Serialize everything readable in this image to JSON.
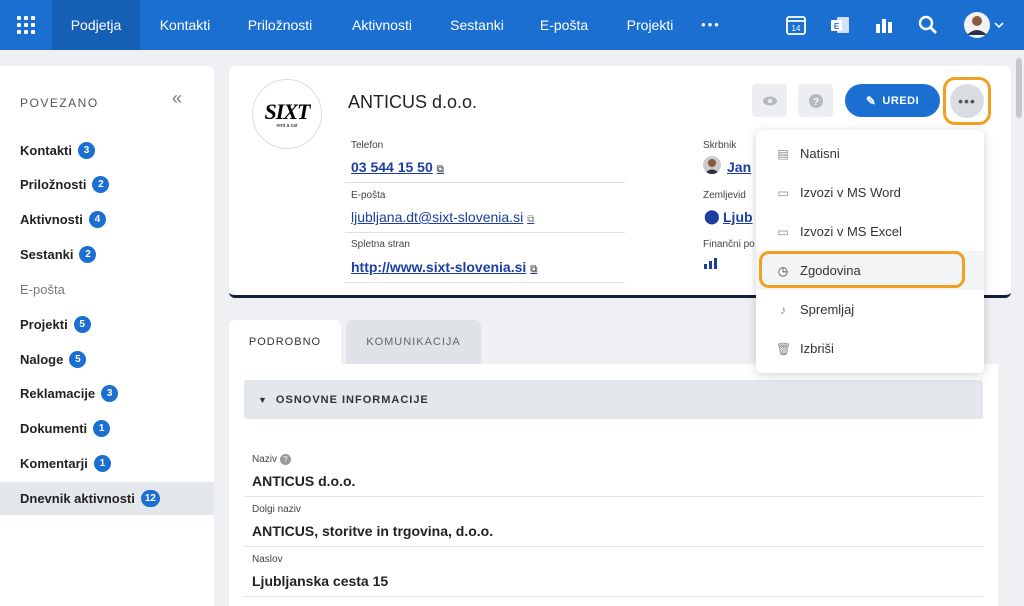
{
  "nav": {
    "items": [
      "Podjetja",
      "Kontakti",
      "Priložnosti",
      "Aktivnosti",
      "Sestanki",
      "E-pošta",
      "Projekti"
    ],
    "more": "•••",
    "calendar_day": "14"
  },
  "sidebar": {
    "title": "POVEZANO",
    "collapse": "«",
    "items": [
      {
        "label": "Kontakti",
        "count": "3"
      },
      {
        "label": "Priložnosti",
        "count": "2"
      },
      {
        "label": "Aktivnosti",
        "count": "4"
      },
      {
        "label": "Sestanki",
        "count": "2"
      },
      {
        "label": "E-pošta",
        "count": ""
      },
      {
        "label": "Projekti",
        "count": "5"
      },
      {
        "label": "Naloge",
        "count": "5"
      },
      {
        "label": "Reklamacije",
        "count": "3"
      },
      {
        "label": "Dokumenti",
        "count": "1"
      },
      {
        "label": "Komentarji",
        "count": "1"
      },
      {
        "label": "Dnevnik aktivnosti",
        "count": "12"
      }
    ]
  },
  "header": {
    "logo_text": "SIXT",
    "logo_sub": "rent a car",
    "company": "ANTICUS d.o.o.",
    "edit_label": "UREDI",
    "fields": {
      "phone_label": "Telefon",
      "phone": "03 544 15 50",
      "email_label": "E-pošta",
      "email": "ljubljana.dt@sixt-slovenia.si",
      "web_label": "Spletna stran",
      "web": "http://www.sixt-slovenia.si",
      "owner_label": "Skrbnik",
      "owner": "Jan",
      "geo_label": "Zemljevid",
      "geo": "Ljub",
      "fin_label": "Finančni po"
    }
  },
  "menu": {
    "items": [
      "Natisni",
      "Izvozi v MS Word",
      "Izvozi v MS Excel",
      "Zgodovina",
      "Spremljaj",
      "Izbriši"
    ]
  },
  "tabs": [
    "PODROBNO",
    "KOMUNIKACIJA"
  ],
  "section_title": "OSNOVNE INFORMACIJE",
  "details": {
    "name_label": "Naziv",
    "name": "ANTICUS d.o.o.",
    "long_label": "Dolgi naziv",
    "long": "ANTICUS, storitve in trgovina, d.o.o.",
    "addr_label": "Naslov",
    "addr": "Ljubljanska cesta 15"
  },
  "colors": {
    "brand": "#1b6fd1",
    "highlight": "#f0a120"
  }
}
